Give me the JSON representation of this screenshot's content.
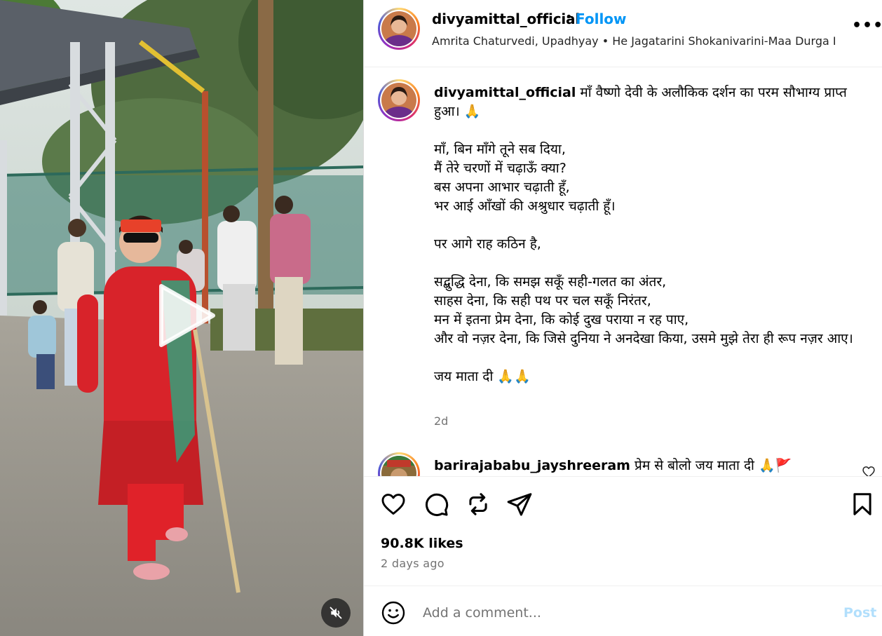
{
  "header": {
    "username": "divyamittal_official",
    "separator": "•",
    "follow_label": "Follow",
    "audio": "Amrita Chaturvedi, Upadhyay • He Jagatarini Shokanivarini-Maa Durga B",
    "more_label": "•••"
  },
  "caption": {
    "username": "divyamittal_official",
    "text": " माँ वैष्णो देवी के अलौकिक दर्शन का परम सौभाग्य प्राप्त हुआ। 🙏\n\nमाँ, बिन माँगे तूने सब दिया,\nमैं तेरे चरणों में चढ़ाऊँ क्या?\nबस अपना आभार चढ़ाती हूँ,\nभर आई आँखों की अश्रुधार चढ़ाती हूँ।\n\nपर आगे राह कठिन है,\n\nसद्बुद्धि देना, कि समझ सकूँ सही-गलत का अंतर,\nसाहस देना, कि सही पथ पर चल सकूँ निरंतर,\nमन में इतना प्रेम देना, कि कोई दुख पराया न रह पाए,\nऔर वो नज़र देना, कि जिसे दुनिया ने अनदेखा किया, उसमे मुझे तेरा ही रूप नज़र आए।\n\nजय माता दी 🙏🙏",
    "time": "2d"
  },
  "comment": {
    "username": "barirajababu_jayshreeram",
    "text": " प्रेम से बोलो जय माता दी 🙏🚩"
  },
  "actions": {
    "likes": "90.8K likes",
    "age": "2 days ago"
  },
  "add_comment": {
    "placeholder": "Add a comment...",
    "post_label": "Post"
  },
  "colors": {
    "link_blue": "#0095f6",
    "post_disabled": "#b2dffc",
    "muted_text": "#737373",
    "divider": "#efefef"
  },
  "icons": {
    "like": "heart-outline-icon",
    "comment": "speech-bubble-icon",
    "repost": "repost-arrows-icon",
    "share": "paper-plane-icon",
    "save": "bookmark-icon",
    "emoji": "smiley-icon",
    "mute": "speaker-muted-icon",
    "play": "play-icon"
  }
}
